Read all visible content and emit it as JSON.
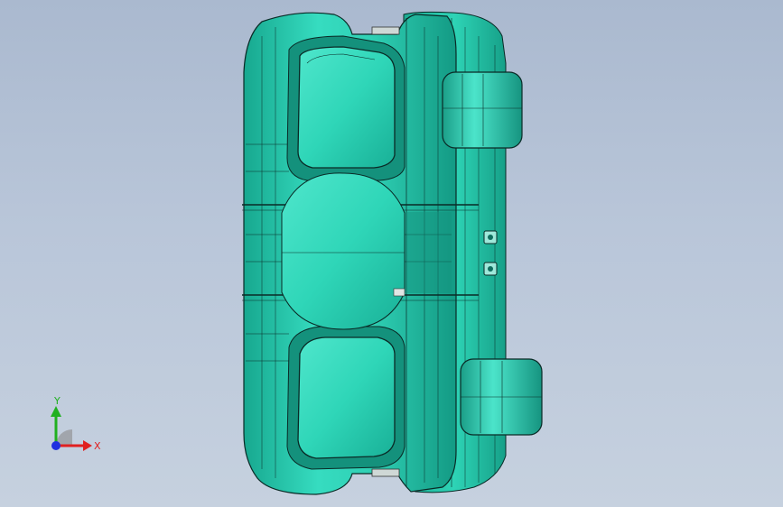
{
  "viewport": {
    "background_top": "#aab9cf",
    "background_bottom": "#c6d1df"
  },
  "model": {
    "body_color": "#2fd6b8",
    "edge_color": "#0a2a26",
    "highlight_color": "#7ff0dc",
    "shadow_color": "#139a84"
  },
  "triad": {
    "x_label": "X",
    "y_label": "Y",
    "x_color": "#e02020",
    "y_color": "#20b020",
    "z_color": "#2030e0"
  }
}
